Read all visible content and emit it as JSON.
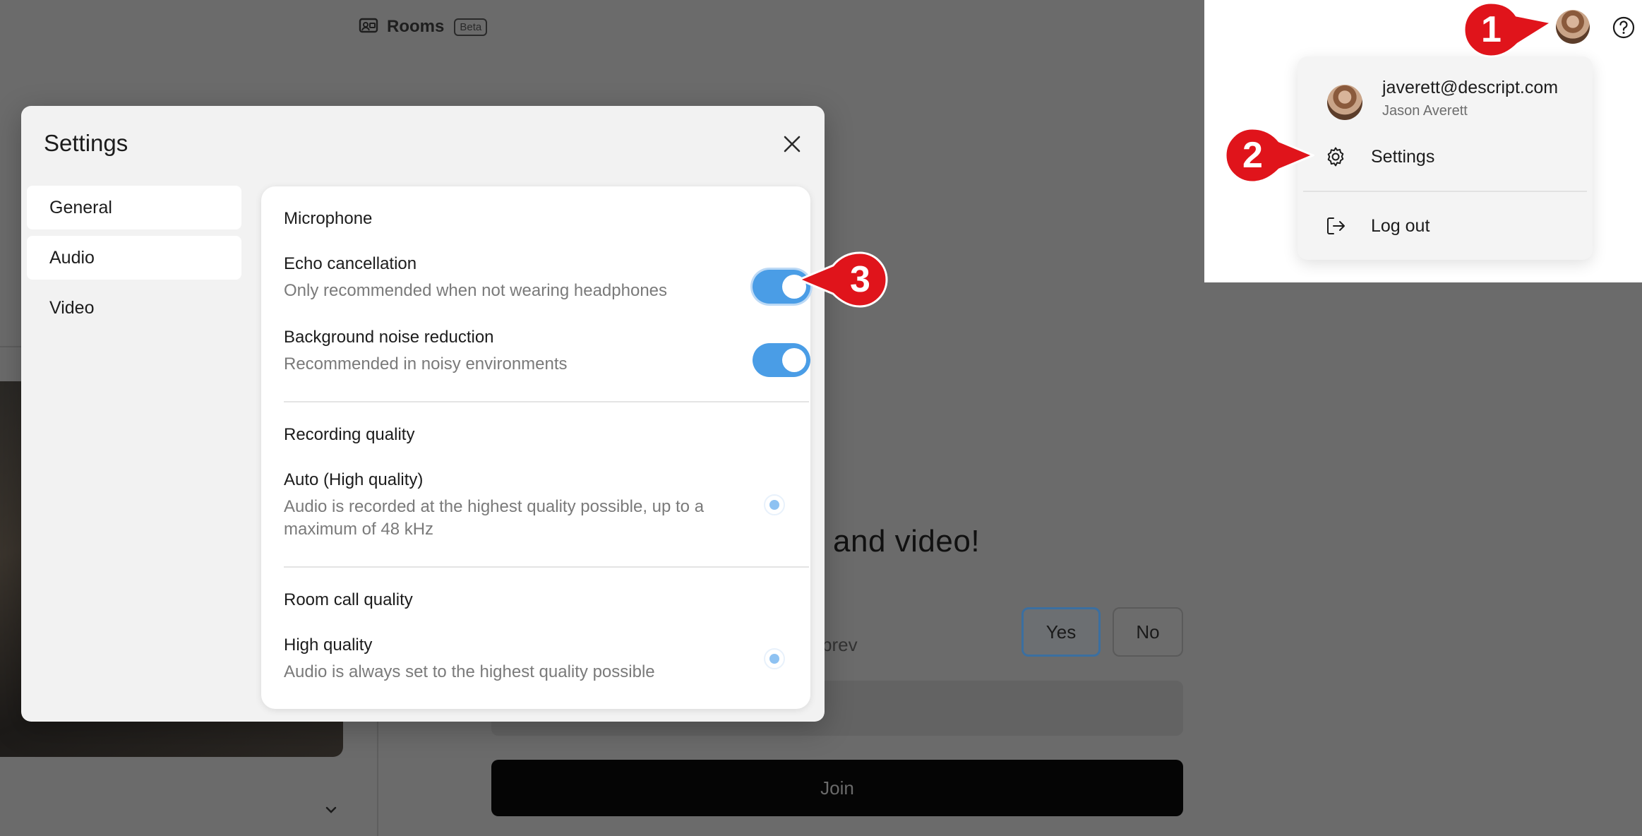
{
  "background": {
    "rooms_label": "Rooms",
    "beta_badge": "Beta",
    "heading_fragment": "and video!",
    "prev_fragment": "prev",
    "yes_label": "Yes",
    "no_label": "No",
    "join_label": "Join"
  },
  "settings": {
    "title": "Settings",
    "nav": [
      {
        "label": "General"
      },
      {
        "label": "Audio"
      },
      {
        "label": "Video"
      }
    ],
    "microphone": {
      "heading": "Microphone",
      "echo_cancellation": {
        "label": "Echo cancellation",
        "description": "Only recommended when not wearing headphones",
        "enabled": true
      },
      "noise_reduction": {
        "label": "Background noise reduction",
        "description": "Recommended in noisy environments",
        "enabled": true
      }
    },
    "recording_quality": {
      "heading": "Recording quality",
      "option_label": "Auto (High quality)",
      "option_desc_line1": "Audio is recorded at the highest quality possible, up to a",
      "option_desc_line2": "maximum of 48 kHz",
      "selected": true
    },
    "room_call_quality": {
      "heading": "Room call quality",
      "option_label": "High quality",
      "option_desc": "Audio is always set to the highest quality possible",
      "selected": true
    }
  },
  "account_menu": {
    "email": "javerett@descript.com",
    "name": "Jason Averett",
    "items": [
      {
        "label": "Settings",
        "icon": "gear-icon"
      },
      {
        "label": "Log out",
        "icon": "logout-icon"
      }
    ]
  },
  "callouts": [
    "1",
    "2",
    "3"
  ],
  "colors": {
    "accent_blue": "#4a9de6",
    "callout_red": "#e0141b",
    "overlay_gray": "#6b6b6b"
  }
}
